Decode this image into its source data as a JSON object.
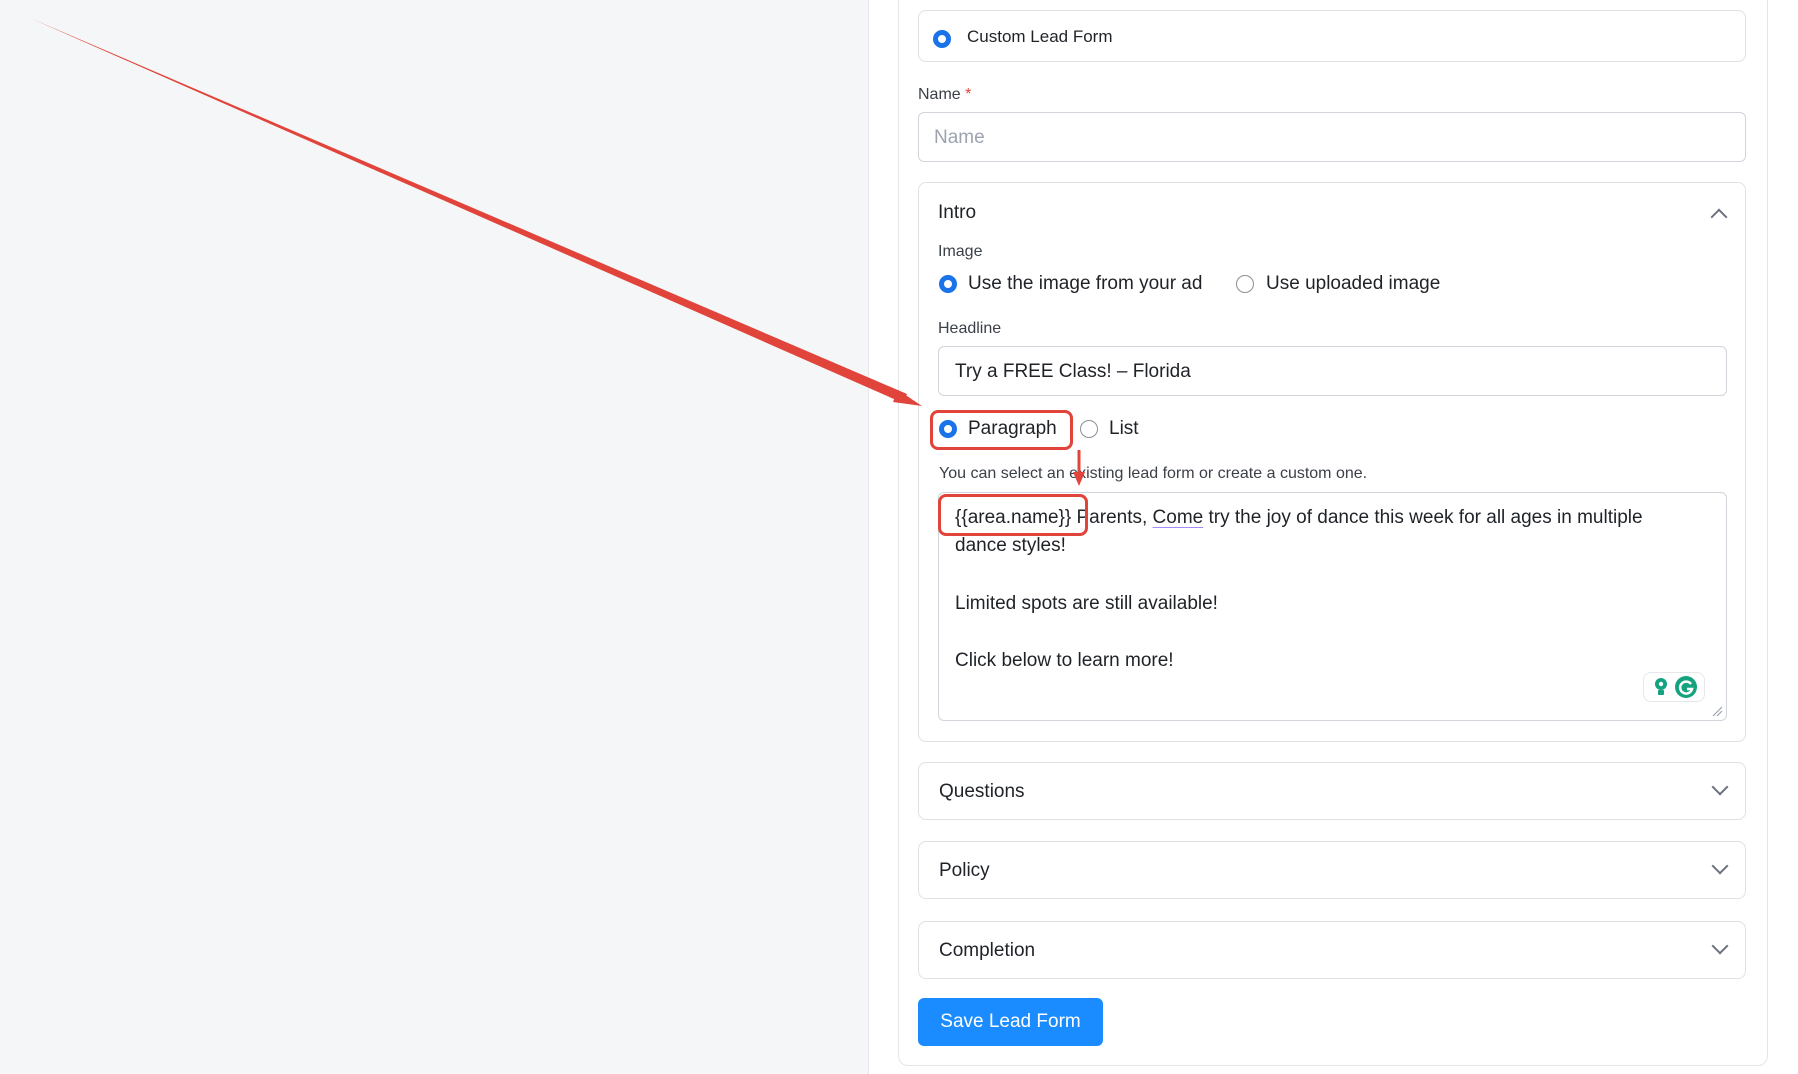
{
  "lead_form_option": {
    "label": "Custom Lead Form",
    "selected": true
  },
  "name_field": {
    "label": "Name",
    "required_marker": "*",
    "placeholder": "Name",
    "value": ""
  },
  "intro": {
    "title": "Intro",
    "image_label": "Image",
    "image_options": [
      "Use the image from your ad",
      "Use uploaded image"
    ],
    "image_selected": 0,
    "headline_label": "Headline",
    "headline_value": "Try a FREE Class! – Florida",
    "format_options": [
      "Paragraph",
      "List"
    ],
    "format_selected": 0,
    "helper_text": "You can select an existing lead form or create a custom one.",
    "paragraph": {
      "token": "{{area.name}}",
      "line1_rest_a": " Parents, ",
      "line1_underlined": "Come",
      "line1_rest_b": " try the joy of dance this week for all ages in multiple",
      "line2": "dance styles!",
      "line3": "Limited spots are still available!",
      "line4": "Click below to learn more!"
    }
  },
  "sections": [
    {
      "title": "Questions"
    },
    {
      "title": "Policy"
    },
    {
      "title": "Completion"
    }
  ],
  "save_button": {
    "label": "Save Lead Form"
  },
  "colors": {
    "accent": "#1a73e8",
    "button": "#1a8cff",
    "annotation": "#e0443a",
    "grammarly": "#15a37f"
  },
  "icons": [
    "chevron-up-icon",
    "chevron-down-icon",
    "lightbulb-icon",
    "grammarly-icon",
    "resize-handle-icon"
  ]
}
